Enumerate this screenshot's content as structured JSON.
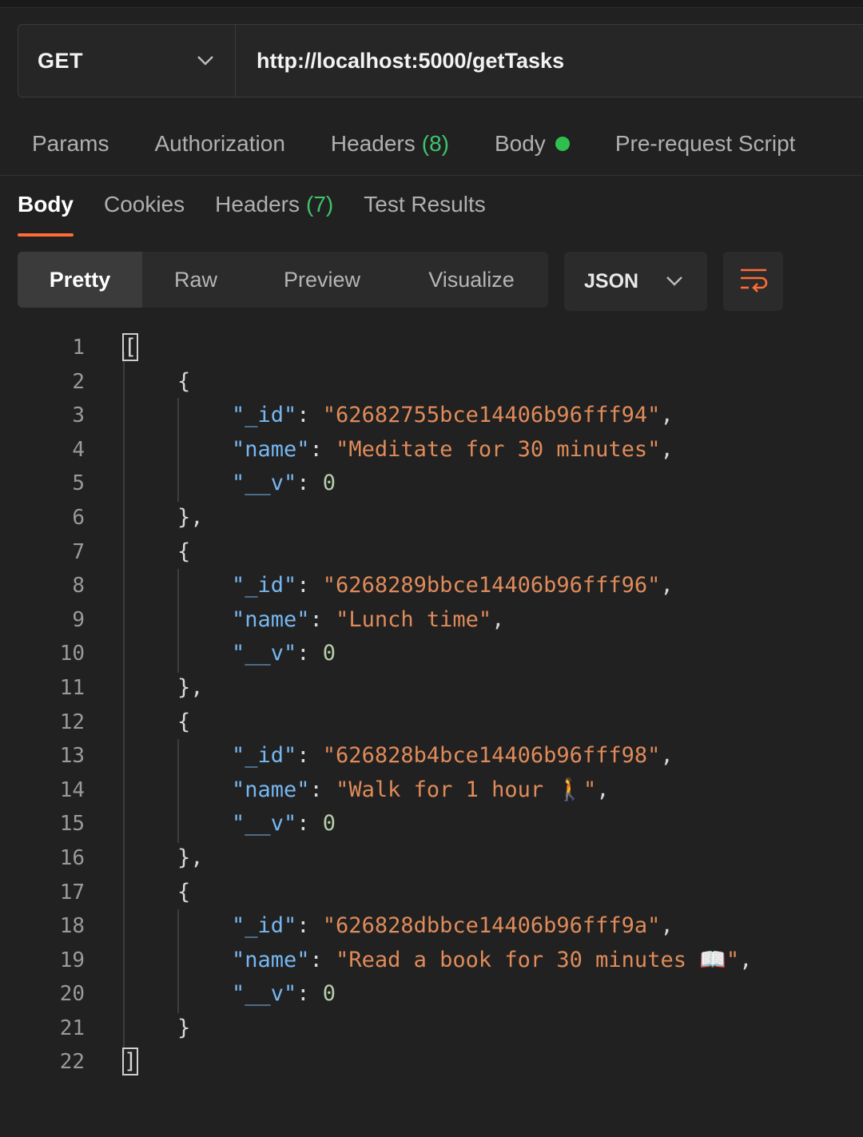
{
  "request": {
    "method": "GET",
    "url": "http://localhost:5000/getTasks"
  },
  "request_tabs": [
    {
      "label": "Params",
      "count": ""
    },
    {
      "label": "Authorization",
      "count": ""
    },
    {
      "label": "Headers",
      "count": "(8)"
    },
    {
      "label": "Body",
      "count": ""
    },
    {
      "label": "Pre-request Script",
      "count": ""
    }
  ],
  "response_tabs": [
    {
      "label": "Body",
      "count": ""
    },
    {
      "label": "Cookies",
      "count": ""
    },
    {
      "label": "Headers",
      "count": "(7)"
    },
    {
      "label": "Test Results",
      "count": ""
    }
  ],
  "view_modes": [
    "Pretty",
    "Raw",
    "Preview",
    "Visualize"
  ],
  "format": "JSON",
  "colors": {
    "accent": "#ff6c37",
    "count_green": "#3fc46a",
    "status_dot": "#2fbf4f",
    "json_key": "#77b7f0",
    "json_string": "#e08b5a",
    "json_number": "#b5cea8"
  },
  "icons": {
    "method_dropdown": "chevron-down-icon",
    "format_dropdown": "chevron-down-icon",
    "wrap": "wrap-lines-icon",
    "body_status": "green-dot-icon"
  },
  "response_body": {
    "line_numbers": [
      "1",
      "2",
      "3",
      "4",
      "5",
      "6",
      "7",
      "8",
      "9",
      "10",
      "11",
      "12",
      "13",
      "14",
      "15",
      "16",
      "17",
      "18",
      "19",
      "20",
      "21",
      "22"
    ],
    "open_bracket": "[",
    "close_bracket": "]",
    "items": [
      {
        "_id": "\"62682755bce14406b96fff94\"",
        "name": "\"Meditate for 30 minutes\"",
        "__v": "0"
      },
      {
        "_id": "\"6268289bbce14406b96fff96\"",
        "name": "\"Lunch time\"",
        "__v": "0"
      },
      {
        "_id": "\"626828b4bce14406b96fff98\"",
        "name": "\"Walk for 1 hour 🚶\"",
        "__v": "0"
      },
      {
        "_id": "\"626828dbbce14406b96fff9a\"",
        "name": "\"Read a book for 30 minutes 📖\"",
        "__v": "0"
      }
    ],
    "keys": {
      "id": "\"_id\"",
      "name": "\"name\"",
      "v": "\"__v\""
    }
  }
}
